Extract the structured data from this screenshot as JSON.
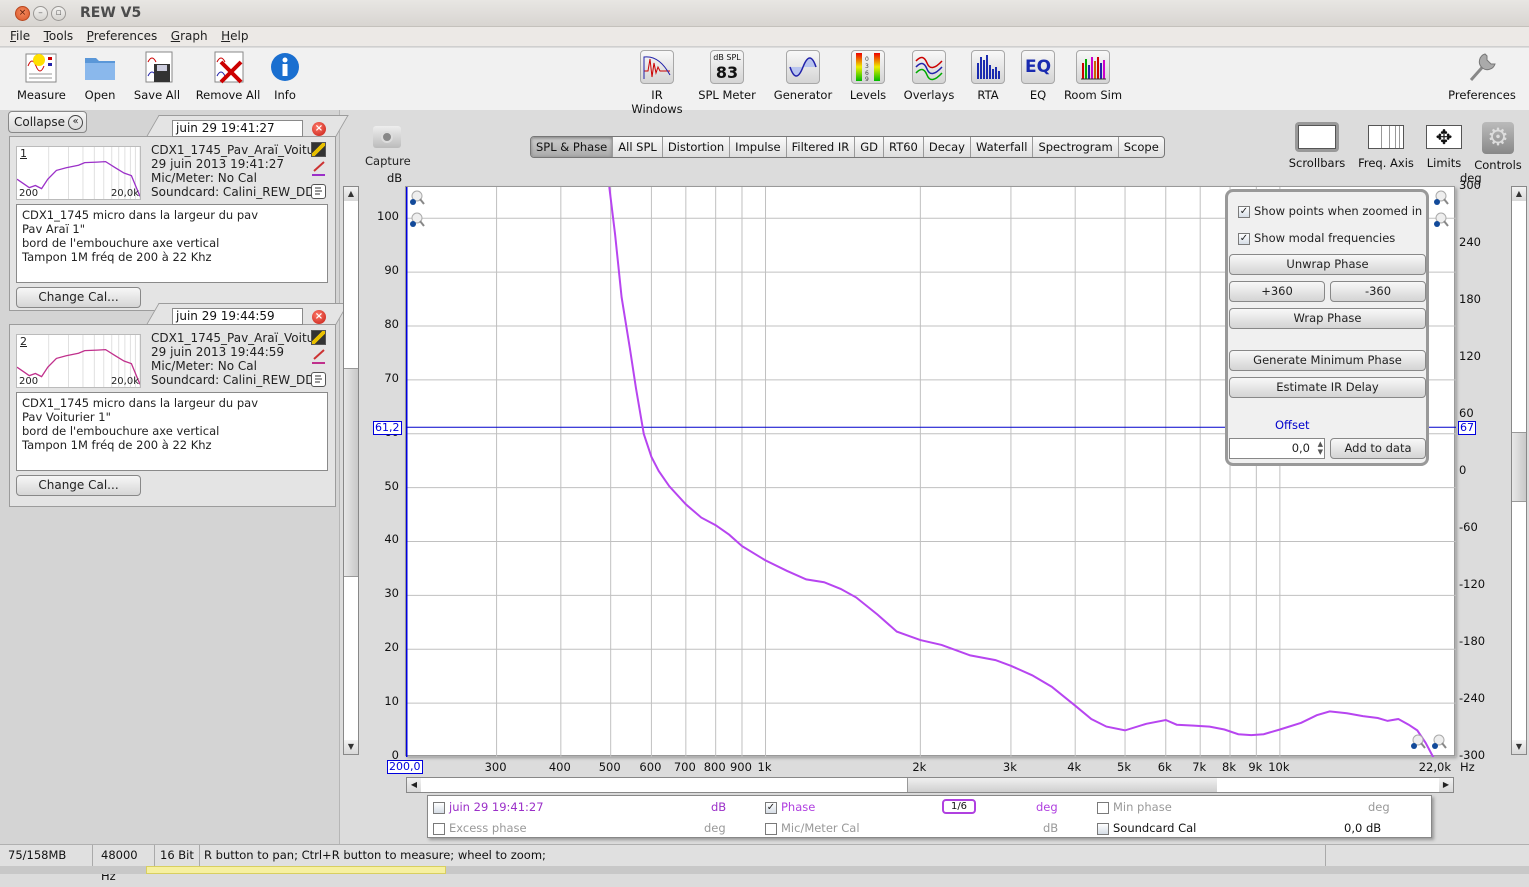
{
  "window": {
    "title": "REW V5",
    "buttons": [
      "close",
      "minimize",
      "maximize"
    ]
  },
  "menu": [
    {
      "label": "File",
      "mnemonic": "F",
      "rest": "ile"
    },
    {
      "label": "Tools",
      "mnemonic": "T",
      "rest": "ools"
    },
    {
      "label": "Preferences",
      "mnemonic": "P",
      "rest": "references"
    },
    {
      "label": "Graph",
      "mnemonic": "G",
      "rest": "raph"
    },
    {
      "label": "Help",
      "mnemonic": "H",
      "rest": "elp"
    }
  ],
  "toolbar": {
    "left": [
      {
        "label": "Measure",
        "icon": "measure-icon"
      },
      {
        "label": "Open",
        "icon": "folder-icon"
      },
      {
        "label": "Save All",
        "icon": "save-all-icon"
      },
      {
        "label": "Remove All",
        "icon": "remove-all-icon"
      },
      {
        "label": "Info",
        "icon": "info-icon"
      }
    ],
    "center": [
      {
        "label": "IR Windows",
        "icon": "ir-windows-icon"
      },
      {
        "label": "SPL Meter",
        "icon": "spl-meter-icon",
        "icon_text_top": "dB SPL",
        "icon_text_value": "83"
      },
      {
        "label": "Generator",
        "icon": "generator-icon"
      },
      {
        "label": "Levels",
        "icon": "levels-icon"
      },
      {
        "label": "Overlays",
        "icon": "overlays-icon"
      },
      {
        "label": "RTA",
        "icon": "rta-icon"
      },
      {
        "label": "EQ",
        "icon": "eq-icon",
        "icon_text": "EQ"
      },
      {
        "label": "Room Sim",
        "icon": "room-sim-icon"
      }
    ],
    "right": {
      "label": "Preferences",
      "icon": "wrench-icon"
    }
  },
  "left_panel": {
    "collapse_label": "Collapse",
    "measurements": [
      {
        "index": "1",
        "name_field": "juin 29 19:41:27",
        "title": "CDX1_1745_Pav_Araï_Voitu",
        "date": "29 juin 2013 19:41:27",
        "mic": "Mic/Meter: No Cal",
        "soundcard": "Soundcard: Calini_REW_DDI",
        "mini_range_start": "200",
        "mini_range_end": "20,0k",
        "notes": [
          "CDX1_1745 micro dans la largeur du pav",
          "Pav Araï 1\"",
          "bord de l'embouchure axe vertical",
          "Tampon 1M fréq de 200 à 22 Khz"
        ],
        "change_cal_label": "Change Cal...",
        "color": "#9b30c8"
      },
      {
        "index": "2",
        "name_field": "juin 29 19:44:59",
        "title": "CDX1_1745_Pav_Araï_Voitu",
        "date": "29 juin 2013 19:44:59",
        "mic": "Mic/Meter: No Cal",
        "soundcard": "Soundcard: Calini_REW_DDI",
        "mini_range_start": "200",
        "mini_range_end": "20,0k",
        "notes": [
          "CDX1_1745 micro dans la largeur du pav",
          "Pav Voiturier 1\"",
          "bord de l'embouchure axe vertical",
          "Tampon 1M fréq de 200 à 22 Khz"
        ],
        "change_cal_label": "Change Cal...",
        "color": "#c0308c"
      }
    ]
  },
  "graph": {
    "capture_label": "Capture",
    "tabs": [
      "SPL & Phase",
      "All SPL",
      "Distortion",
      "Impulse",
      "Filtered IR",
      "GD",
      "RT60",
      "Decay",
      "Waterfall",
      "Spectrogram",
      "Scope"
    ],
    "active_tab": "SPL & Phase",
    "right_tools": [
      {
        "label": "Scrollbars",
        "icon": "scrollbars-icon"
      },
      {
        "label": "Freq. Axis",
        "icon": "freq-axis-icon"
      },
      {
        "label": "Limits",
        "icon": "limits-icon"
      },
      {
        "label": "Controls",
        "icon": "gear-icon"
      }
    ],
    "left_axis_unit": "dB",
    "right_axis_unit": "deg",
    "x_unit": "Hz",
    "cursor_left_value": "61,2",
    "cursor_right_value": "67",
    "x_start_value": "200,0",
    "controls": {
      "show_points_label": "Show points when zoomed in",
      "show_points_checked": true,
      "show_modal_label": "Show modal frequencies",
      "show_modal_checked": true,
      "unwrap_label": "Unwrap Phase",
      "plus360_label": "+360",
      "minus360_label": "-360",
      "wrap_label": "Wrap Phase",
      "gen_min_phase_label": "Generate Minimum Phase",
      "estimate_ir_label": "Estimate IR Delay",
      "offset_label": "Offset",
      "offset_value": "0,0",
      "add_to_data_label": "Add to data"
    },
    "legend": {
      "row1": [
        {
          "label": "juin 29 19:41:27",
          "unit": "dB",
          "checked": false,
          "color": "#9b30c8"
        },
        {
          "label": "Phase",
          "unit": "deg",
          "checked": true,
          "color": "#b040e0",
          "smoothing": "1/6"
        },
        {
          "label": "Min phase",
          "unit": "deg",
          "checked": false,
          "color": "#999999"
        }
      ],
      "row2": [
        {
          "label": "Excess phase",
          "unit": "deg",
          "checked": false,
          "color": "#999999"
        },
        {
          "label": "Mic/Meter Cal",
          "unit": "dB",
          "checked": false,
          "color": "#999999"
        },
        {
          "label": "Soundcard Cal",
          "unit": "0,0 dB",
          "checked": false,
          "color": "#111111"
        }
      ]
    }
  },
  "chart_data": {
    "type": "line",
    "title": "SPL & Phase",
    "xlabel": "Hz",
    "ylabel": "dB",
    "y2label": "deg",
    "x_scale": "log",
    "xlim": [
      200,
      22000
    ],
    "ylim": [
      0,
      105.8
    ],
    "y2lim": [
      -300,
      300
    ],
    "x_ticks": [
      {
        "v": 200,
        "label": "200,0"
      },
      {
        "v": 300,
        "label": "300"
      },
      {
        "v": 400,
        "label": "400"
      },
      {
        "v": 500,
        "label": "500"
      },
      {
        "v": 600,
        "label": "600"
      },
      {
        "v": 700,
        "label": "700"
      },
      {
        "v": 800,
        "label": "800"
      },
      {
        "v": 900,
        "label": "900"
      },
      {
        "v": 1000,
        "label": "1k"
      },
      {
        "v": 2000,
        "label": "2k"
      },
      {
        "v": 3000,
        "label": "3k"
      },
      {
        "v": 4000,
        "label": "4k"
      },
      {
        "v": 5000,
        "label": "5k"
      },
      {
        "v": 6000,
        "label": "6k"
      },
      {
        "v": 7000,
        "label": "7k"
      },
      {
        "v": 8000,
        "label": "8k"
      },
      {
        "v": 9000,
        "label": "9k"
      },
      {
        "v": 10000,
        "label": "10k"
      },
      {
        "v": 22000,
        "label": "22,0k"
      }
    ],
    "y_ticks": [
      0,
      10,
      20,
      30,
      40,
      50,
      60,
      70,
      80,
      90,
      100
    ],
    "y2_ticks": [
      -300,
      -240,
      -180,
      -120,
      -60,
      0,
      60,
      120,
      180,
      240,
      300
    ],
    "grid": true,
    "cursor": {
      "left_y": 61.2,
      "right_y": 67
    },
    "series": [
      {
        "name": "Phase",
        "axis": "right",
        "color": "#b745f0",
        "smoothing": "1/6",
        "points": [
          [
            497,
            300
          ],
          [
            510,
            250
          ],
          [
            525,
            184
          ],
          [
            545,
            130
          ],
          [
            560,
            88
          ],
          [
            580,
            40
          ],
          [
            600,
            16
          ],
          [
            620,
            1
          ],
          [
            650,
            -15
          ],
          [
            700,
            -34
          ],
          [
            750,
            -48
          ],
          [
            800,
            -56
          ],
          [
            850,
            -66
          ],
          [
            900,
            -78
          ],
          [
            1000,
            -93
          ],
          [
            1100,
            -104
          ],
          [
            1200,
            -113
          ],
          [
            1300,
            -116
          ],
          [
            1400,
            -123
          ],
          [
            1500,
            -132
          ],
          [
            1650,
            -150
          ],
          [
            1800,
            -168
          ],
          [
            2000,
            -177
          ],
          [
            2200,
            -182
          ],
          [
            2500,
            -193
          ],
          [
            2800,
            -198
          ],
          [
            3000,
            -204
          ],
          [
            3300,
            -214
          ],
          [
            3600,
            -226
          ],
          [
            4000,
            -246
          ],
          [
            4300,
            -260
          ],
          [
            4600,
            -268
          ],
          [
            5000,
            -272
          ],
          [
            5500,
            -265
          ],
          [
            6000,
            -261
          ],
          [
            6300,
            -266
          ],
          [
            6800,
            -267
          ],
          [
            7300,
            -268
          ],
          [
            7800,
            -271
          ],
          [
            8300,
            -276
          ],
          [
            8800,
            -277
          ],
          [
            9300,
            -276
          ],
          [
            10000,
            -271
          ],
          [
            11000,
            -264
          ],
          [
            11800,
            -256
          ],
          [
            12500,
            -252
          ],
          [
            13500,
            -254
          ],
          [
            14500,
            -257
          ],
          [
            15500,
            -259
          ],
          [
            16200,
            -262
          ],
          [
            17000,
            -260
          ],
          [
            17800,
            -266
          ],
          [
            18500,
            -272
          ],
          [
            19200,
            -285
          ],
          [
            20000,
            -303
          ],
          [
            20800,
            -322
          ],
          [
            21500,
            -345
          ],
          [
            22000,
            -368
          ]
        ]
      }
    ],
    "legend": [
      "juin 29 19:41:27",
      "Phase",
      "Min phase",
      "Excess phase",
      "Mic/Meter Cal",
      "Soundcard Cal"
    ]
  },
  "status_bar": {
    "memory": "75/158MB",
    "sample_rate": "48000 Hz",
    "bit_depth": "16 Bit",
    "hint": "R button to pan; Ctrl+R button to measure; wheel to zoom;"
  }
}
